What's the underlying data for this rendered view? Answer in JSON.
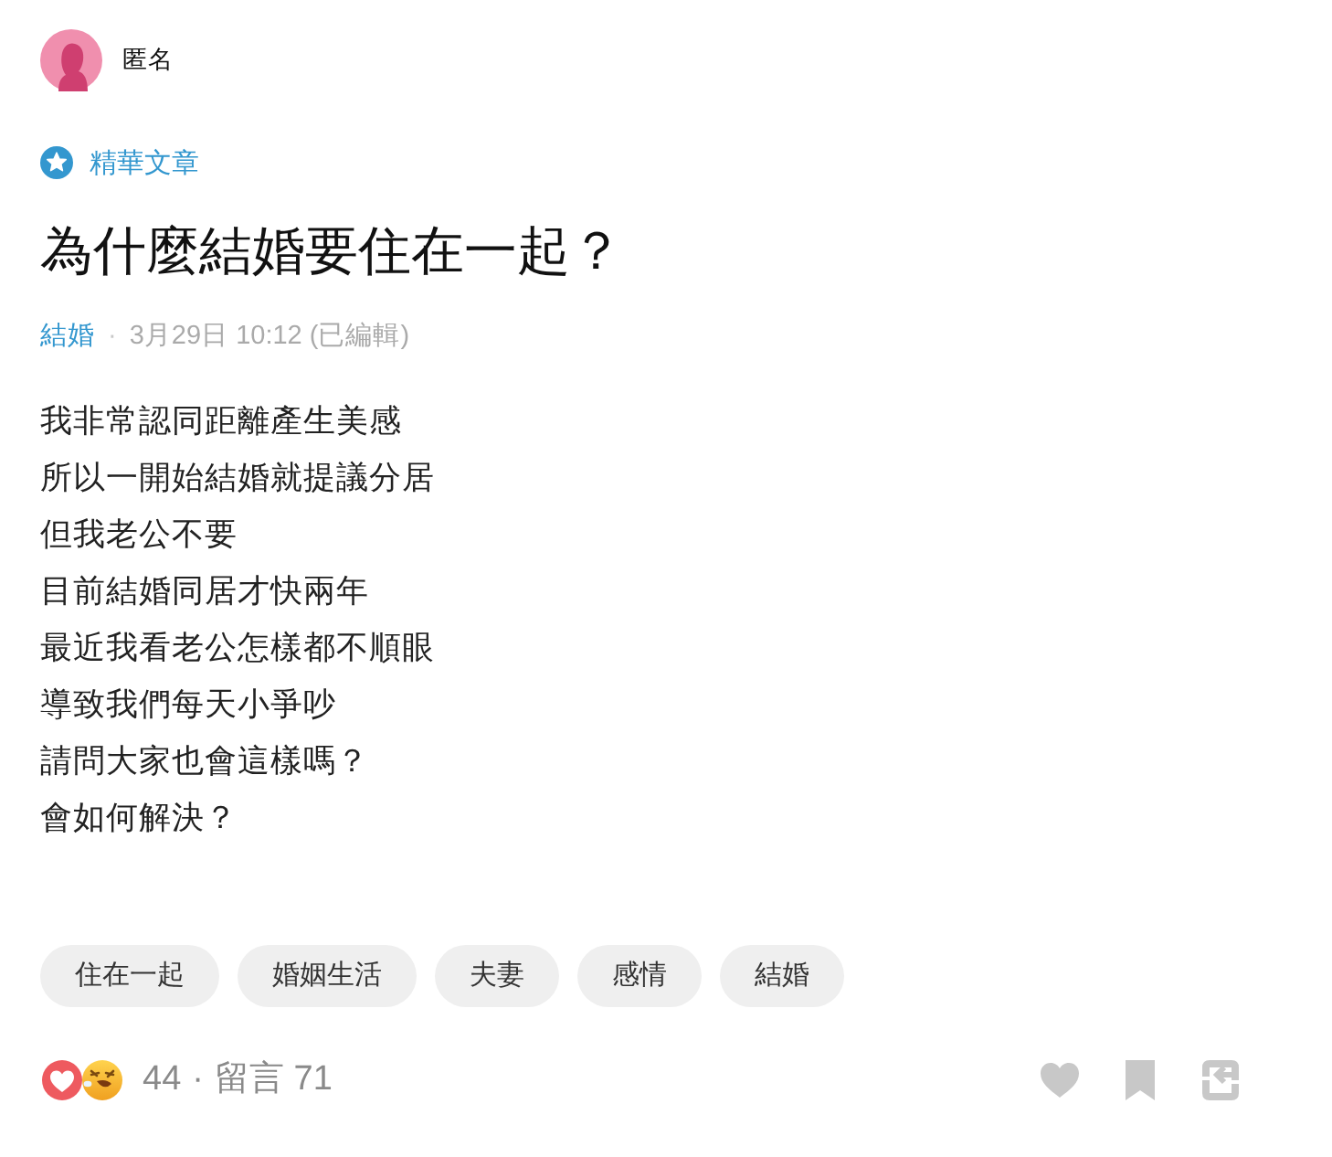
{
  "author": {
    "name": "匿名"
  },
  "badge": {
    "label": "精華文章"
  },
  "post": {
    "title": "為什麼結婚要住在一起？",
    "forum": "結婚",
    "separator": "·",
    "timestamp": "3月29日 10:12 (已編輯)",
    "body": [
      "我非常認同距離產生美感",
      "所以一開始結婚就提議分居",
      "但我老公不要",
      "目前結婚同居才快兩年",
      "最近我看老公怎樣都不順眼",
      "導致我們每天小爭吵",
      "請問大家也會這樣嗎？",
      "會如何解決？"
    ]
  },
  "tags": [
    "住在一起",
    "婚姻生活",
    "夫妻",
    "感情",
    "結婚"
  ],
  "footer": {
    "reaction_count": "44",
    "separator": "·",
    "comments": "留言 71",
    "actions": [
      {
        "kind": "like"
      },
      {
        "kind": "bookmark"
      },
      {
        "kind": "share"
      }
    ]
  }
}
